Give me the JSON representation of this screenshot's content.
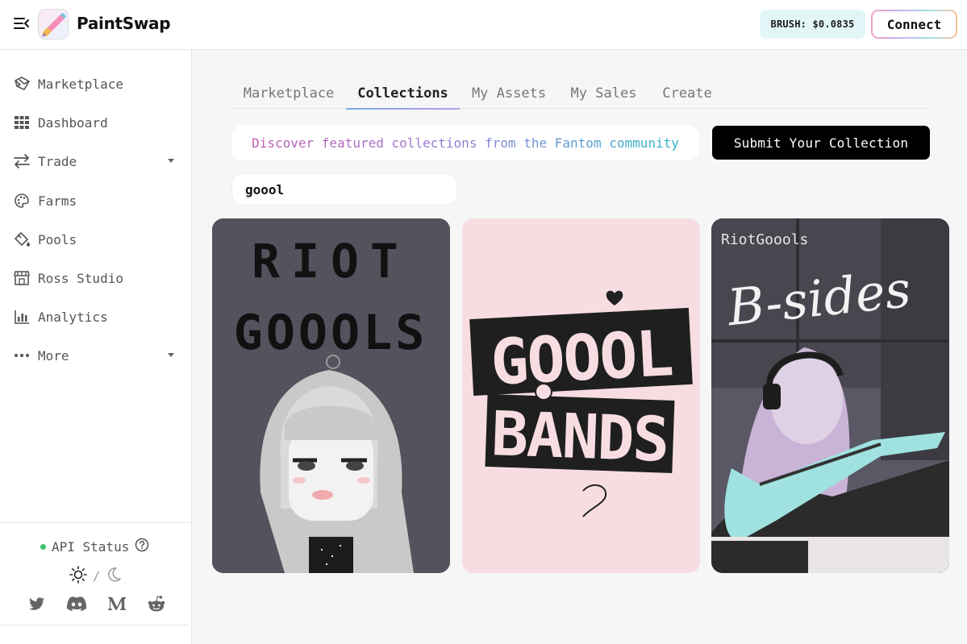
{
  "header": {
    "brand": "PaintSwap",
    "price_label": "BRUSH: $0.0835",
    "connect_label": "Connect"
  },
  "sidebar": {
    "items": [
      {
        "label": "Marketplace",
        "icon": "marketplace-icon"
      },
      {
        "label": "Dashboard",
        "icon": "grid-icon"
      },
      {
        "label": "Trade",
        "icon": "swap-arrows-icon",
        "dropdown": true
      },
      {
        "label": "Farms",
        "icon": "palette-icon"
      },
      {
        "label": "Pools",
        "icon": "paint-bucket-icon"
      },
      {
        "label": "Ross Studio",
        "icon": "storefront-icon"
      },
      {
        "label": "Analytics",
        "icon": "bar-chart-icon"
      },
      {
        "label": "More",
        "icon": "ellipsis-icon",
        "dropdown": true
      }
    ],
    "api_status": "API Status",
    "theme_separator": "/",
    "social": [
      "twitter-icon",
      "discord-icon",
      "medium-icon",
      "reddit-icon"
    ]
  },
  "tabs": [
    "Marketplace",
    "Collections",
    "My Assets",
    "My Sales",
    "Create"
  ],
  "active_tab": "Collections",
  "discover": {
    "text": "Discover featured collections from the Fantom community"
  },
  "submit_label": "Submit Your Collection",
  "search": {
    "value": "goool"
  },
  "cards": [
    {
      "name": "riot-goools",
      "art_text": [
        "RIOT",
        "GOOOLS"
      ],
      "bg": "#55515d"
    },
    {
      "name": "goool-bands",
      "art_text": [
        "GOOOL",
        "BANDS"
      ],
      "bg": "#f7dde2"
    },
    {
      "name": "goool-b-sides",
      "art_text": [
        "RiotGoools",
        "B-sides"
      ],
      "bg": "#5a5865"
    }
  ],
  "colors": {
    "accent_gradient": [
      "#c45ab4",
      "#8f7ed6",
      "#2bb5c8"
    ],
    "status_green": "#3cc36a",
    "price_badge_bg": "#e2f6f7"
  }
}
